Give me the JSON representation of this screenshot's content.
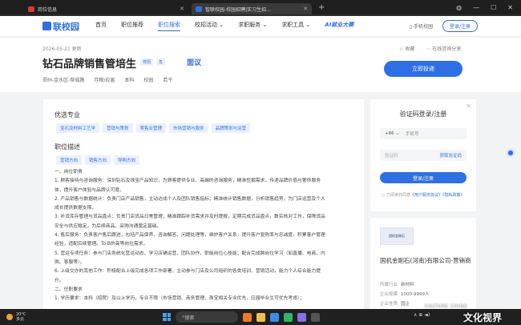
{
  "browser": {
    "tabs": [
      {
        "title": "岗位信息"
      },
      {
        "title": "智联校园-校园招聘|实习生招..."
      }
    ]
  },
  "header": {
    "logo": "联校园",
    "nav": [
      "首页",
      "职位推荐",
      "职位搜索",
      "校招活动 ⌄",
      "求职服务 ⌄",
      "求职工具 ⌄",
      "AI就业大赛"
    ],
    "mobile": "手机校园",
    "login": "登录/注册"
  },
  "job": {
    "updated": "2026-05-21 更新",
    "title": "钻石品牌销售管培生",
    "tag1": "校招",
    "tag2": "急",
    "salary": "面议",
    "meta": [
      "郑州-金水区-祭城路",
      "存粮/应届",
      "本科",
      "校园",
      "若干"
    ],
    "collect": "☆ 收藏",
    "share": "⋯ 在线咨询分享",
    "apply": "立即投递"
  },
  "main": {
    "majors_title": "优选专业",
    "majors": [
      "宝石及材料工艺学",
      "营销与策划",
      "零售业管理",
      "市场营销与服务",
      "品牌策划与运营"
    ],
    "desc_title": "职位描述",
    "desc_tags": [
      "营销方向",
      "销售方向",
      "导购方向"
    ],
    "lines": [
      "一、岗位职责",
      "1. 顾客接待与咨询服务：深圳钻石及珠宝产品知识，为顾客提供专业、高端的咨询服务，精准挖掘需求，传递品牌价值与奢侈服务",
      "体，提升客户体验与品牌认可度。",
      "2. 产品销售与数据统计：负责门店产品销售，主动达成个人及团队销售指标；精准统计销售数据，分析销售趋势，为门店运营及个人",
      "成长提供数据支撑。",
      "3. 补货库存管理与货品盘点：负责门店货品日常管理，精准跟踪补货需求并及时提报，定期完成货品盘点，数实核对工作，保障货品",
      "安全与供应稳定，为后续商品、采购沟通奠定基础。",
      "4. 售后服务：负责客户售后跟进，包括产品保养、咨询解答、问题处理等，维护客户关系，提升客户复购率与忠诚度，积累客户管理",
      "经验，适配后续管理。To B的高等岗位需求。",
      "5. 营运专项任务：参与门店系统化营运动态、学习店铺运营、团队协作、职能岗位心技能；配合完成跨岗位学习（如直播、电商、内",
      "购、客服等）。",
      "6. 上级交办的其他工作：积极配合上级完成各项工作部署，主动参与门店及公司组织的各类培训、营销活动，能力个人综合能力提",
      "升。",
      "二、任职要求",
      "1. 学历要求：本科（招院）及以上学历，专业不限（市场营销、商务管理、珠宝相关专业优先，应届毕业生可优先考虑）；"
    ]
  },
  "sidebar": {
    "title": "验证码登录/注册",
    "country_code": "+86 ⌄",
    "phone_placeholder": "手机号",
    "code_placeholder": "验证码",
    "get_code": "获取验证码",
    "submit": "登录/注册",
    "agree_pre": "已阅读并同意",
    "agree_link": "《用户服务协议》《隐私政策》"
  },
  "company": {
    "logo_text": "国机金刚石",
    "name": "国机金刚石(河南)有限公司-营销商",
    "industry_label": "所属行业",
    "industry": "新材料",
    "size_label": "企业规模",
    "size": "1000-9999人",
    "type_label": "企业性质",
    "type": "国企"
  },
  "taskbar": {
    "temp": "20°C",
    "weather": "多云",
    "search": "搜索",
    "time": "∧ ⊕ ◄)"
  },
  "watermark": {
    "big": "文化视界",
    "small": "CULTURE CHINA"
  },
  "colors": {
    "accent": "#2f6fe5"
  }
}
